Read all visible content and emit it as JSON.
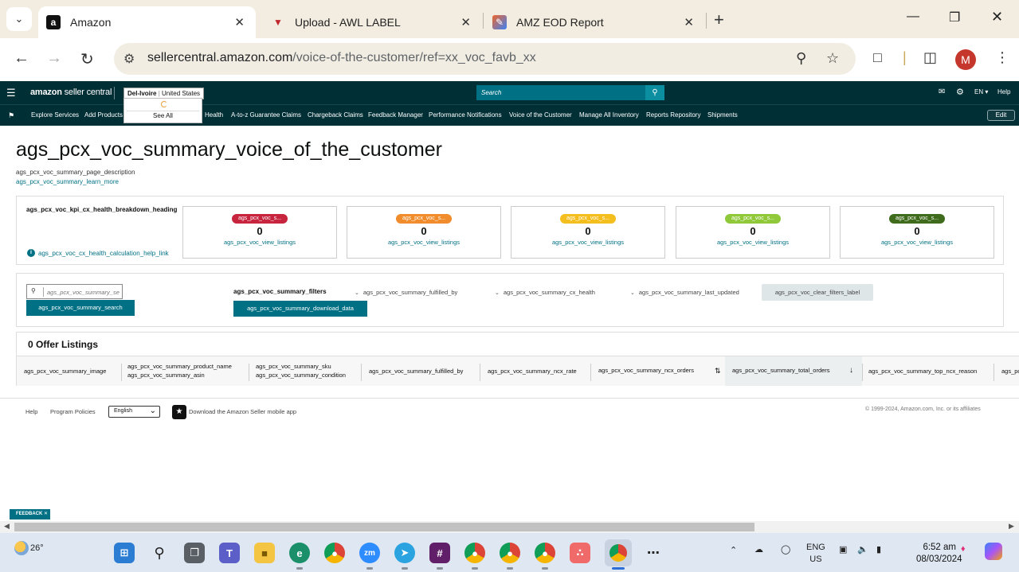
{
  "browser": {
    "tabs": [
      {
        "title": "Amazon",
        "favicon": "amazon-icon",
        "active": true
      },
      {
        "title": "Upload - AWL LABEL",
        "favicon": "awl-label-icon",
        "active": false
      },
      {
        "title": "AMZ EOD Report",
        "favicon": "amz-eod-icon",
        "active": false
      }
    ],
    "url_host": "sellercentral.amazon.com",
    "url_path": "/voice-of-the-customer/ref=xx_voc_favb_xx",
    "profile_initial": "M"
  },
  "sc_header": {
    "logo_brand": "amazon",
    "logo_product": "seller central",
    "account_name": "Del-Ivoire",
    "account_marketplace": "United States",
    "account_dropdown_see_all": "See All",
    "search_placeholder": "Search",
    "language": "EN",
    "help": "Help"
  },
  "sc_nav": {
    "items": [
      "Explore Services",
      "Add Products",
      "Health",
      "A-to-z Guarantee Claims",
      "Chargeback Claims",
      "Feedback Manager",
      "Performance Notifications",
      "Voice of the Customer",
      "Manage All Inventory",
      "Reports Repository",
      "Shipments"
    ],
    "edit": "Edit"
  },
  "page": {
    "title": "ags_pcx_voc_summary_voice_of_the_customer",
    "description": "ags_pcx_voc_summary_page_description",
    "learn_more": "ags_pcx_voc_summary_learn_more"
  },
  "kpi": {
    "heading": "ags_pcx_voc_kpi_cx_health_breakdown_heading",
    "help_link": "ags_pcx_voc_cx_health_calculation_help_link",
    "cards": [
      {
        "label": "ags_pcx_voc_s...",
        "value": "0",
        "link": "ags_pcx_voc_view_listings",
        "color": "#c7253e"
      },
      {
        "label": "ags_pcx_voc_s...",
        "value": "0",
        "link": "ags_pcx_voc_view_listings",
        "color": "#f08c2b"
      },
      {
        "label": "ags_pcx_voc_s...",
        "value": "0",
        "link": "ags_pcx_voc_view_listings",
        "color": "#f4be1f"
      },
      {
        "label": "ags_pcx_voc_s...",
        "value": "0",
        "link": "ags_pcx_voc_view_listings",
        "color": "#8fc93a"
      },
      {
        "label": "ags_pcx_voc_s...",
        "value": "0",
        "link": "ags_pcx_voc_view_listings",
        "color": "#3e6b1c"
      }
    ]
  },
  "filters": {
    "search_placeholder": "ags_pcx_voc_summary_search",
    "search_button": "ags_pcx_voc_summary_search",
    "filters_label": "ags_pcx_voc_summary_filters",
    "download_button": "ags_pcx_voc_summary_download_data",
    "fulfilled_by": "ags_pcx_voc_summary_fulfilled_by",
    "cx_health": "ags_pcx_voc_summary_cx_health",
    "last_updated": "ags_pcx_voc_summary_last_updated",
    "clear": "ags_pcx_voc_clear_filters_label"
  },
  "listings": {
    "title": "0 Offer Listings",
    "columns": {
      "image": "ags_pcx_voc_summary_image",
      "product_name": "ags_pcx_voc_summary_product_name",
      "asin": "ags_pcx_voc_summary_asin",
      "sku": "ags_pcx_voc_summary_sku",
      "condition": "ags_pcx_voc_summary_condition",
      "fulfilled_by": "ags_pcx_voc_summary_fulfilled_by",
      "ncx_rate": "ags_pcx_voc_summary_ncx_rate",
      "ncx_orders": "ags_pcx_voc_summary_ncx_orders",
      "total_orders": "ags_pcx_voc_summary_total_orders",
      "top_ncx_reason": "ags_pcx_voc_summary_top_ncx_reason",
      "truncated": "ags_pc"
    }
  },
  "footer": {
    "help": "Help",
    "program_policies": "Program Policies",
    "language": "English",
    "app_download": "Download the Amazon Seller mobile app",
    "copyright": "© 1999-2024, Amazon.com, Inc. or its affiliates"
  },
  "feedback": "FEEDBACK",
  "taskbar": {
    "temperature": "26°",
    "lang_line1": "ENG",
    "lang_line2": "US",
    "time": "6:52 am",
    "date": "08/03/2024"
  }
}
